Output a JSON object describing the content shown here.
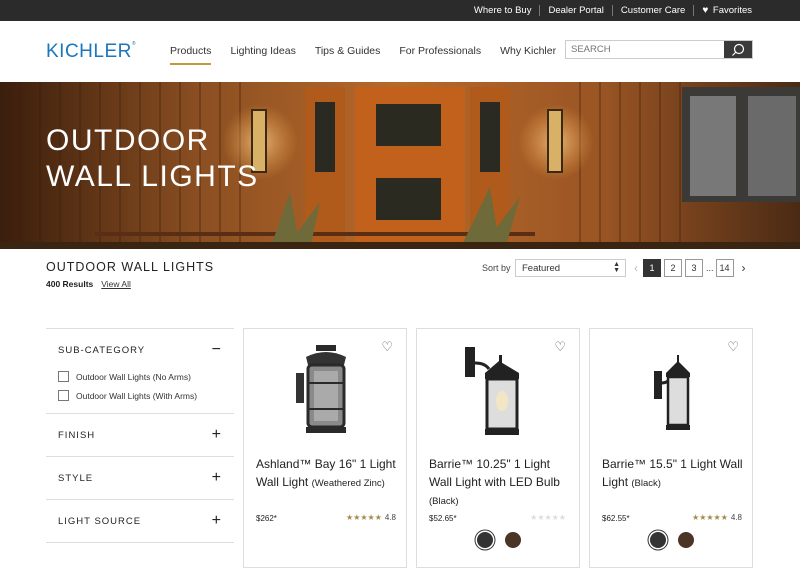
{
  "utility": {
    "links": [
      "Where to Buy",
      "Dealer Portal",
      "Customer Care"
    ],
    "favorites": "Favorites"
  },
  "header": {
    "logo": "KICHLER",
    "nav": [
      "Products",
      "Lighting Ideas",
      "Tips & Guides",
      "For Professionals",
      "Why Kichler"
    ],
    "search_placeholder": "SEARCH"
  },
  "hero": {
    "line1": "OUTDOOR",
    "line2": "WALL LIGHTS"
  },
  "listing": {
    "title": "OUTDOOR WALL LIGHTS",
    "results": "400 Results",
    "view_all": "View All",
    "sort_label": "Sort by",
    "sort_value": "Featured",
    "pages": [
      "1",
      "2",
      "3",
      "14"
    ],
    "ellipsis": "..."
  },
  "filters": {
    "subcategory": "SUB-CATEGORY",
    "options": [
      "Outdoor Wall Lights (No Arms)",
      "Outdoor Wall Lights (With Arms)"
    ],
    "finish": "FINISH",
    "style": "STYLE",
    "light_source": "LIGHT SOURCE"
  },
  "products": [
    {
      "name": "Ashland™ Bay 16\" 1 Light Wall Light",
      "finish": "(Weathered Zinc)",
      "price": "$262*",
      "stars": "★★★★★",
      "rating": "4.8"
    },
    {
      "name": "Barrie™ 10.25\" 1 Light Wall Light with LED Bulb",
      "finish": "(Black)",
      "price": "$52.65*",
      "stars": "★★★★★",
      "rating": ""
    },
    {
      "name": "Barrie™ 15.5\" 1 Light Wall Light",
      "finish": "(Black)",
      "price": "$62.55*",
      "stars": "★★★★★",
      "rating": "4.8"
    }
  ]
}
